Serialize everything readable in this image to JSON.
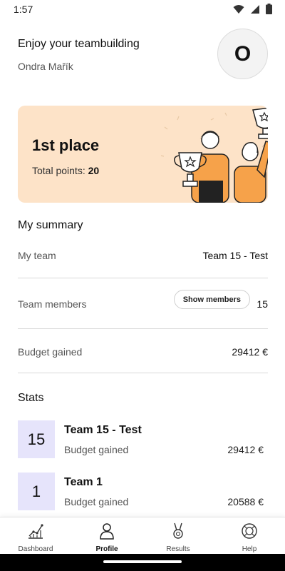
{
  "status_bar": {
    "time": "1:57",
    "icons": [
      "wifi-icon",
      "signal-icon",
      "battery-icon"
    ]
  },
  "header": {
    "greeting": "Enjoy your teambuilding",
    "user_name": "Ondra Mařík",
    "avatar_initial": "O"
  },
  "place_card": {
    "title": "1st place",
    "points_label": "Total points:",
    "points_value": "20",
    "background": "#fde3c8"
  },
  "summary": {
    "title": "My summary",
    "my_team_label": "My team",
    "my_team_value": "Team 15 - Test",
    "members_label": "Team members",
    "show_members_label": "Show members",
    "members_count": "15",
    "budget_label": "Budget gained",
    "budget_value": "29412 €"
  },
  "stats": {
    "title": "Stats",
    "items": [
      {
        "rank": "15",
        "team": "Team 15 - Test",
        "label": "Budget gained",
        "value": "29412 €"
      },
      {
        "rank": "1",
        "team": "Team 1",
        "label": "Budget gained",
        "value": "20588 €"
      }
    ]
  },
  "nav": {
    "items": [
      {
        "label": "Dashboard",
        "icon": "chart-icon"
      },
      {
        "label": "Profile",
        "icon": "person-icon"
      },
      {
        "label": "Results",
        "icon": "medal-icon"
      },
      {
        "label": "Help",
        "icon": "help-icon"
      }
    ],
    "active": "Profile"
  },
  "colors": {
    "accent_orange": "#f6a24a",
    "rank_box": "#e6e4fb"
  }
}
